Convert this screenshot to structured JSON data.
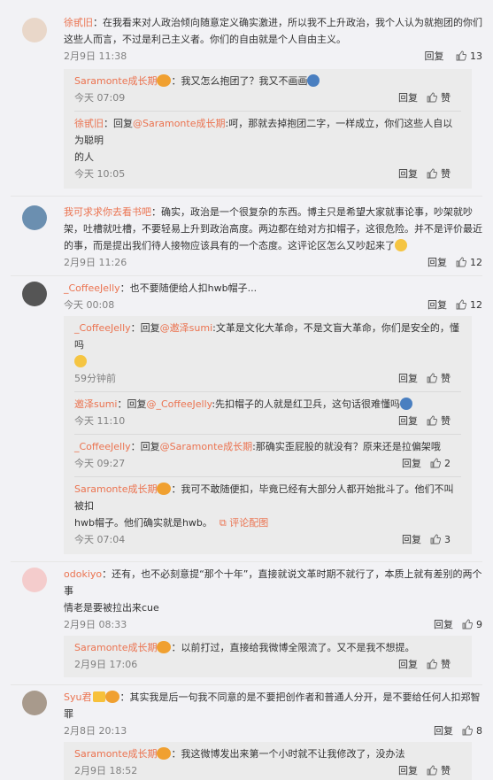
{
  "actions": {
    "reply": "回复",
    "like": "赞"
  },
  "c1": {
    "name": "徐甙旧",
    "text1": "：在我看来对人政治倾向随意定义确实激进，所以我不上升政治，我个人认为就抱团的你们",
    "text2": "这些人而言，不过是利己主义者。你们的自由就是个人自由主义。",
    "time": "2月9日 11:38",
    "likes": "13",
    "replies": [
      {
        "name": "Saramonte成长期",
        "text": "：我又怎么抱团了？我又不画画",
        "time": "今天 07:09",
        "likes": "赞"
      },
      {
        "name": "徐甙旧",
        "pre": "：回复",
        "at": "@Saramonte成长期",
        "text": ":呵，那就去掉抱团二字，一样成立，你们这些人自以为聪明",
        "text2": "的人",
        "time": "今天 10:05",
        "likes": "赞"
      }
    ]
  },
  "c2": {
    "name": "我可求求你去看书吧",
    "text1": "：确实，政治是一个很复杂的东西。博主只是希望大家就事论事，吵架就吵",
    "text2": "架，吐槽就吐槽，不要轻易上升到政治高度。两边都在给对方扣帽子，这很危险。并不是评价最近",
    "text3": "的事，而是提出我们待人接物应该具有的一个态度。这评论区怎么又吵起来了",
    "time": "2月9日 11:26",
    "likes": "12"
  },
  "c3": {
    "name": "_CoffeeJelly",
    "text1": "：也不要随便给人扣hwb帽子...",
    "time": "今天 00:08",
    "likes": "12",
    "replies": [
      {
        "name": "_CoffeeJelly",
        "pre": "：回复",
        "at": "@邀泽sumi",
        "text": ":文革是文化大革命，不是文盲大革命，你们是安全的，懂吗",
        "time": "59分钟前",
        "likes": "赞"
      },
      {
        "name": "邀泽sumi",
        "pre": "：回复",
        "at": "@_CoffeeJelly",
        "text": ":先扣帽子的人就是红卫兵，这句话很难懂吗",
        "time": "今天 11:10",
        "likes": "赞"
      },
      {
        "name": "_CoffeeJelly",
        "pre": "：回复",
        "at": "@Saramonte成长期",
        "text": ":那确实歪屁股的就没有？原来还是拉偏架哦",
        "time": "今天 09:27",
        "likes": "2"
      },
      {
        "name": "Saramonte成长期",
        "text": "：我可不敢随便扣，毕竟已经有大部分人都开始批斗了。他们不叫被扣",
        "text2": "hwb帽子。他们确实就是hwb。",
        "gallery": "评论配图",
        "time": "今天 07:04",
        "likes": "3"
      }
    ]
  },
  "c4": {
    "name": "odokiyo",
    "text1": "：还有，也不必刻意提“那个十年”，直接就说文革时期不就行了，本质上就有差别的两个事",
    "text2": "情老是要被拉出来cue",
    "time": "2月9日 08:33",
    "likes": "9",
    "replies": [
      {
        "name": "Saramonte成长期",
        "text": "：以前打过，直接给我微博全限流了。又不是我不想提。",
        "time": "2月9日 17:06",
        "likes": "赞"
      }
    ]
  },
  "c5": {
    "name": "Syu君",
    "text1": "：其实我是后一句我不同意的是不要把创作者和普通人分开，是不要给任何人扣郑智",
    "text2": "罪",
    "time": "2月8日 20:13",
    "likes": "8",
    "replies": [
      {
        "name": "Saramonte成长期",
        "text": "：我这微博发出来第一个小时就不让我修改了，没办法",
        "time": "2月9日 18:52",
        "likes": "赞"
      }
    ]
  },
  "colors": {
    "name": "#eb7350",
    "bg": "#f2f2f5",
    "reply_bg": "#ebebeb"
  }
}
